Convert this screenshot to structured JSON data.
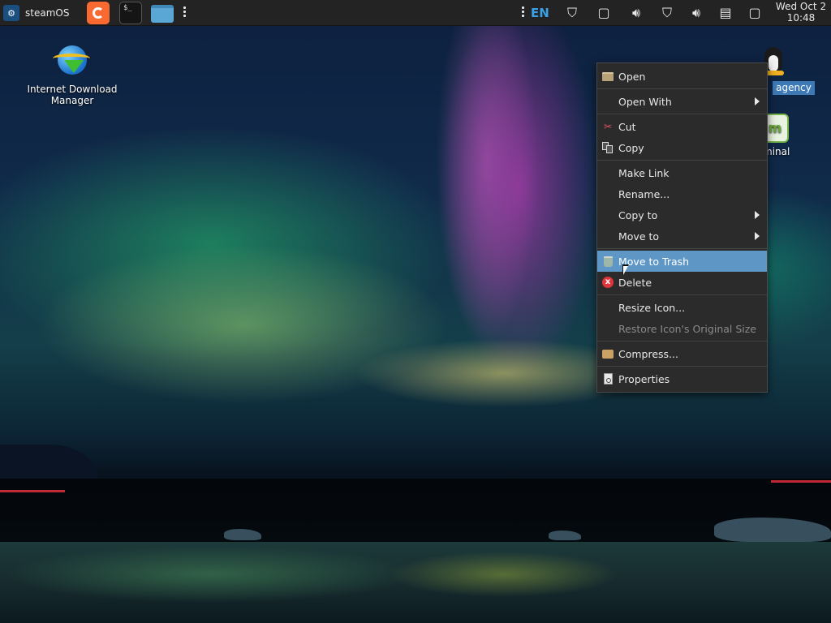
{
  "panel": {
    "menu_label": "steamOS",
    "language": "EN",
    "clock_date": "Wed Oct  2",
    "clock_time": "10:48",
    "launchers": [
      "firefox-icon",
      "terminal-icon",
      "file-manager-icon"
    ],
    "terminal_glyph": "$_",
    "tray_icons": [
      "shield-icon",
      "window-icon",
      "volume-icon",
      "shield-icon",
      "volume-icon",
      "clipboard-icon",
      "window-icon"
    ]
  },
  "desktop": {
    "icons": [
      {
        "label": "Internet Download Manager",
        "icon": "idm-icon"
      },
      {
        "label": "agency",
        "icon": "tux-icon",
        "selected": true
      },
      {
        "label": "minal",
        "icon": "mint-terminal-icon",
        "badge": "m"
      }
    ]
  },
  "context_menu": {
    "items": [
      {
        "label": "Open",
        "icon": "folder-icon"
      },
      {
        "label": "Open With",
        "submenu": true
      },
      {
        "label": "Cut",
        "icon": "scissors-icon"
      },
      {
        "label": "Copy",
        "icon": "copy-icon"
      },
      {
        "label": "Make Link"
      },
      {
        "label": "Rename..."
      },
      {
        "label": "Copy to",
        "submenu": true
      },
      {
        "label": "Move to",
        "submenu": true
      },
      {
        "label": "Move to Trash",
        "icon": "trash-icon",
        "highlighted": true
      },
      {
        "label": "Delete",
        "icon": "delete-icon"
      },
      {
        "label": "Resize Icon..."
      },
      {
        "label": "Restore Icon's Original Size",
        "disabled": true
      },
      {
        "label": "Compress...",
        "icon": "archive-icon"
      },
      {
        "label": "Properties",
        "icon": "properties-icon"
      }
    ],
    "delete_glyph": "x"
  },
  "colors": {
    "panel_bg": "#232323",
    "menu_bg": "#2b2b2b",
    "highlight": "#5e97c6",
    "language_accent": "#3aa0e8"
  }
}
